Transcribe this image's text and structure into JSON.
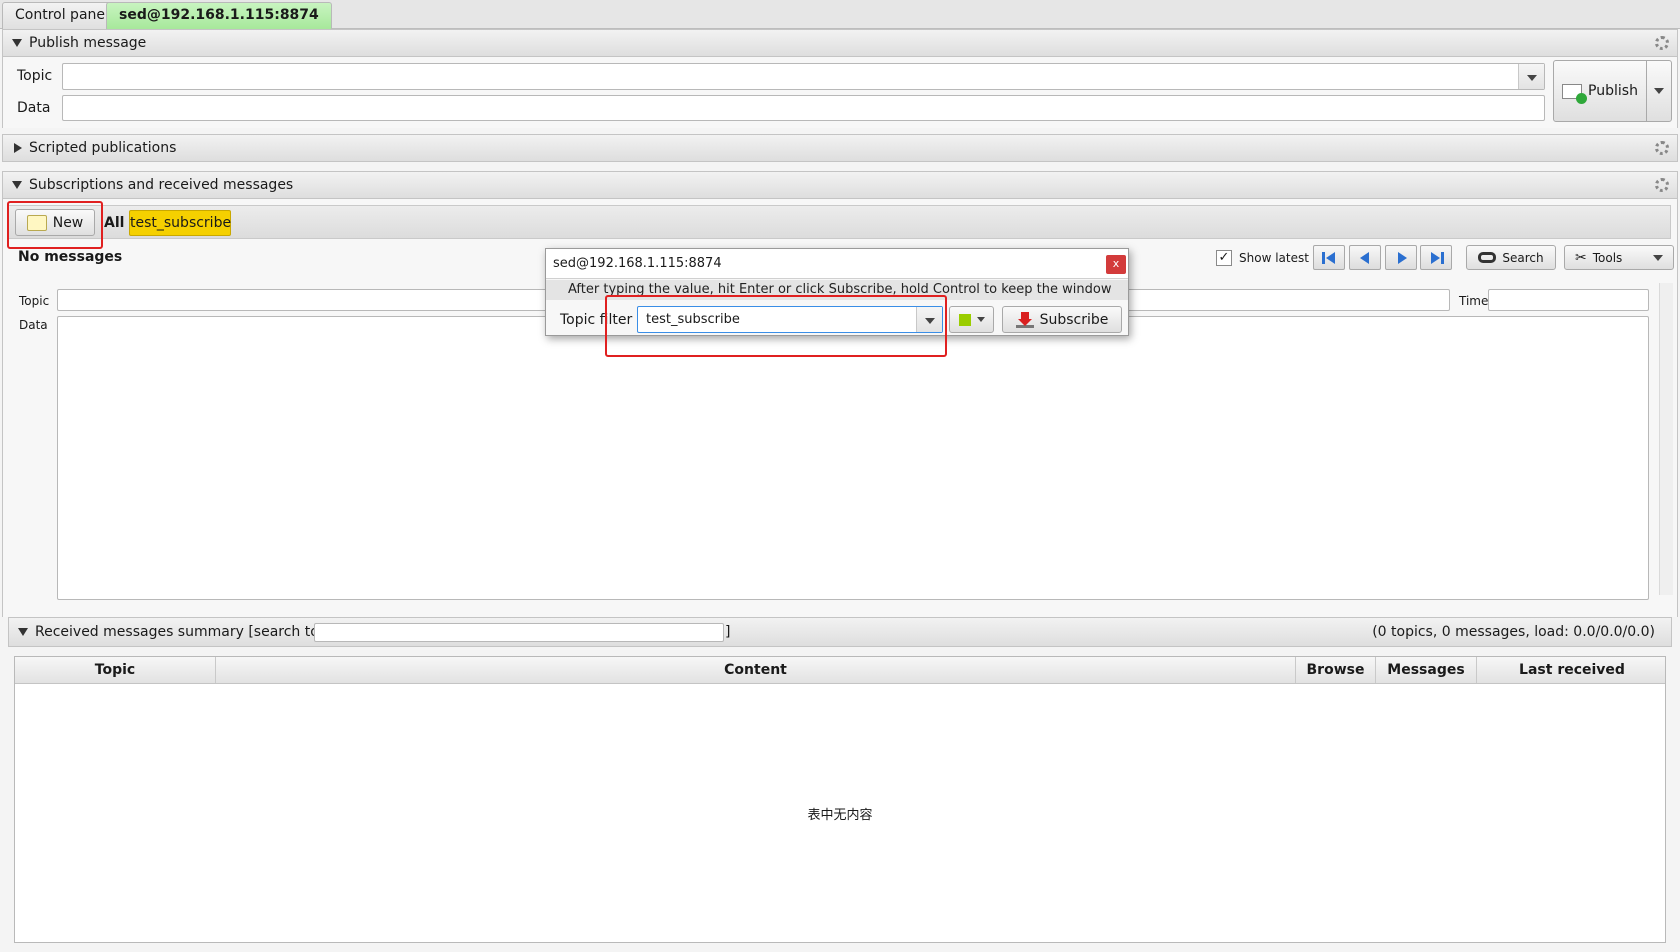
{
  "tabs": [
    {
      "label": "Control panel",
      "active": false
    },
    {
      "label": "sed@192.168.1.115:8874",
      "active": true
    }
  ],
  "publish": {
    "header": "Publish message",
    "topic_label": "Topic",
    "data_label": "Data",
    "topic_value": "",
    "data_value": "",
    "publish_button": "Publish"
  },
  "scripted": {
    "header": "Scripted publications"
  },
  "subscriptions": {
    "header": "Subscriptions and received messages",
    "new_button": "New",
    "all_tab": "All",
    "subscription_tab": "test_subscribe",
    "subscription_tab_color": "#f5d000",
    "no_messages": "No messages",
    "show_latest_label": "Show latest",
    "show_latest_checked": true,
    "search_button": "Search",
    "tools_button": "Tools",
    "topic_label": "Topic",
    "time_label": "Time",
    "data_label": "Data"
  },
  "summary": {
    "header_prefix": "Received messages summary [search topics:",
    "header_suffix": "]",
    "search_value": "",
    "stats": "(0 topics, 0 messages, load: 0.0/0.0/0.0)",
    "columns": [
      "Topic",
      "Content",
      "Browse",
      "Messages",
      "Last received"
    ],
    "empty_text": "表中无内容"
  },
  "popup": {
    "title": "sed@192.168.1.115:8874",
    "close": "x",
    "hint": "After typing the value, hit Enter or click Subscribe, hold Control to keep the window",
    "topic_filter_label": "Topic filter",
    "topic_filter_value": "test_subscribe",
    "color_swatch": "#9acd00",
    "subscribe_button": "Subscribe"
  },
  "colors": {
    "highlight": "#e02020",
    "active_tab": "#a7e89b"
  }
}
